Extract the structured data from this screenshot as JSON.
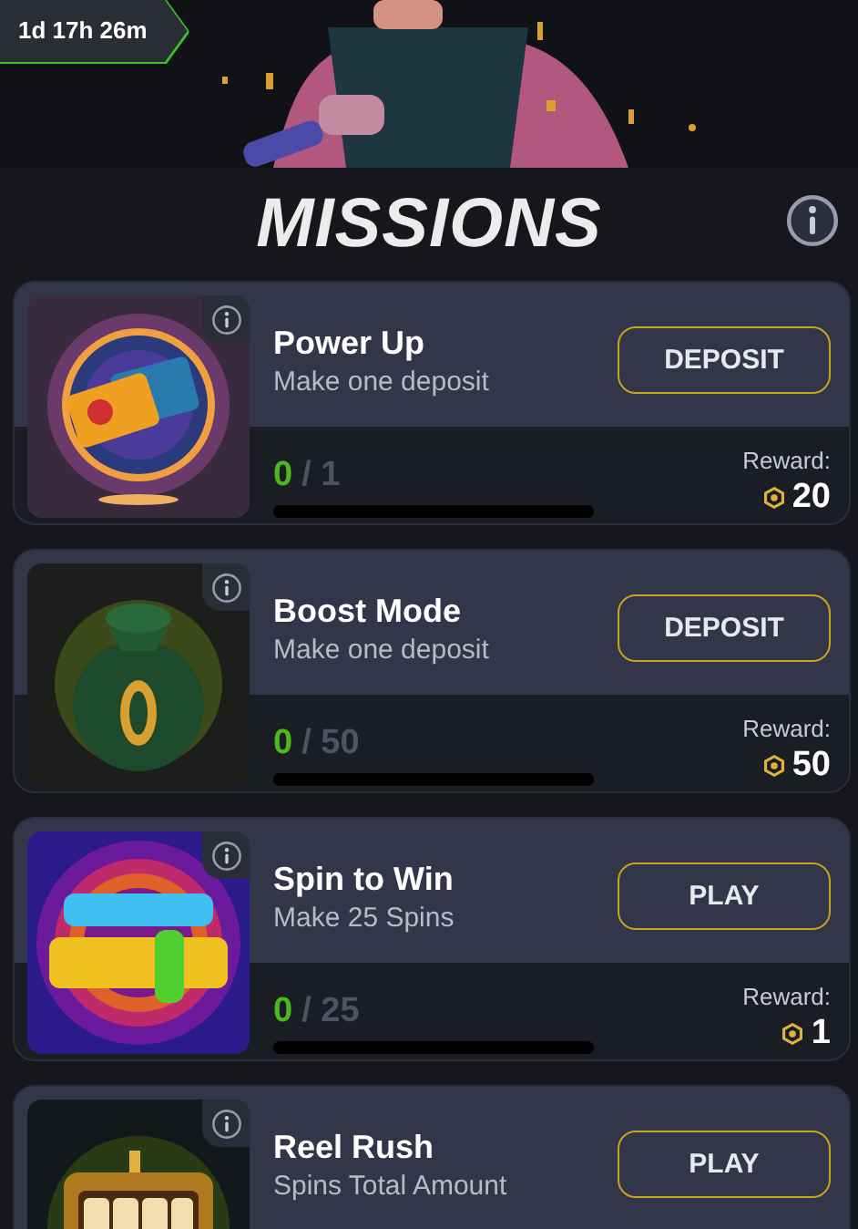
{
  "banner": {
    "timer": "1d 17h 26m"
  },
  "title": "MISSIONS",
  "missions": [
    {
      "title": "Power Up",
      "subtitle": "Make one deposit",
      "button": "DEPOSIT",
      "current": "0",
      "total": "/ 1",
      "level": 0,
      "reward_label": "Reward:",
      "reward": "20"
    },
    {
      "title": "Boost Mode",
      "subtitle": "Make one deposit",
      "button": "DEPOSIT",
      "current": "0",
      "total": "/ 50",
      "level": 0,
      "reward_label": "Reward:",
      "reward": "50"
    },
    {
      "title": "Spin to Win",
      "subtitle": "Make 25 Spins",
      "button": "PLAY",
      "current": "0",
      "total": "/ 25",
      "level": 0,
      "reward_label": "Reward:",
      "reward": "1"
    },
    {
      "title": "Reel Rush",
      "subtitle": "Spins Total Amount",
      "button": "PLAY"
    }
  ]
}
